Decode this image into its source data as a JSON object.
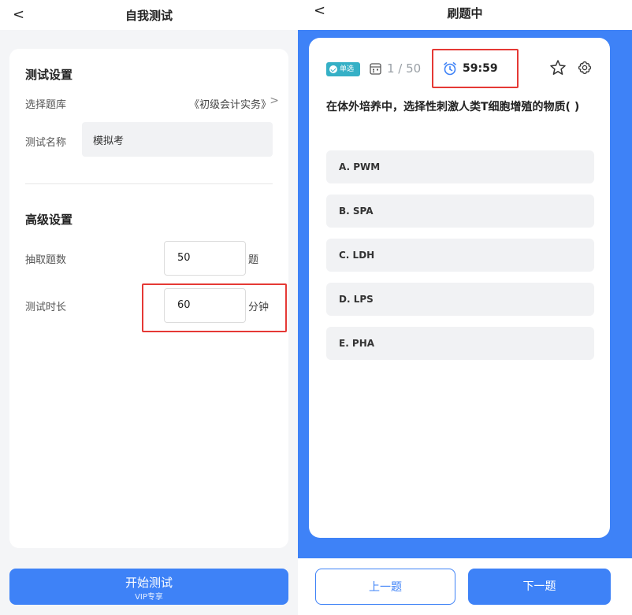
{
  "left": {
    "back": "<",
    "title": "自我测试",
    "test_settings": {
      "heading": "测试设置",
      "bank_label": "选择题库",
      "bank_value": "《初级会计实务》",
      "chevron": ">",
      "name_label": "测试名称",
      "name_value": "模拟考"
    },
    "advanced_settings": {
      "heading": "高级设置",
      "count_label": "抽取题数",
      "count_value": "50",
      "count_unit": "题",
      "duration_label": "测试时长",
      "duration_value": "60",
      "duration_unit": "分钟"
    },
    "start_button": {
      "label": "开始测试",
      "sub": "VIP专享"
    }
  },
  "right": {
    "back": "<",
    "title": "刷题中",
    "badge": "单选",
    "progress": "1 / 50",
    "timer": "59:59",
    "question": "在体外培养中，选择性刺激人类T细胞增殖的物质( )",
    "options": [
      "A. PWM",
      "B. SPA",
      "C. LDH",
      "D. LPS",
      "E. PHA"
    ],
    "prev_button": "上一题",
    "next_button": "下一题"
  },
  "colors": {
    "accent": "#3e82f7",
    "highlight": "#e53935",
    "badge": "#35b0c6"
  }
}
